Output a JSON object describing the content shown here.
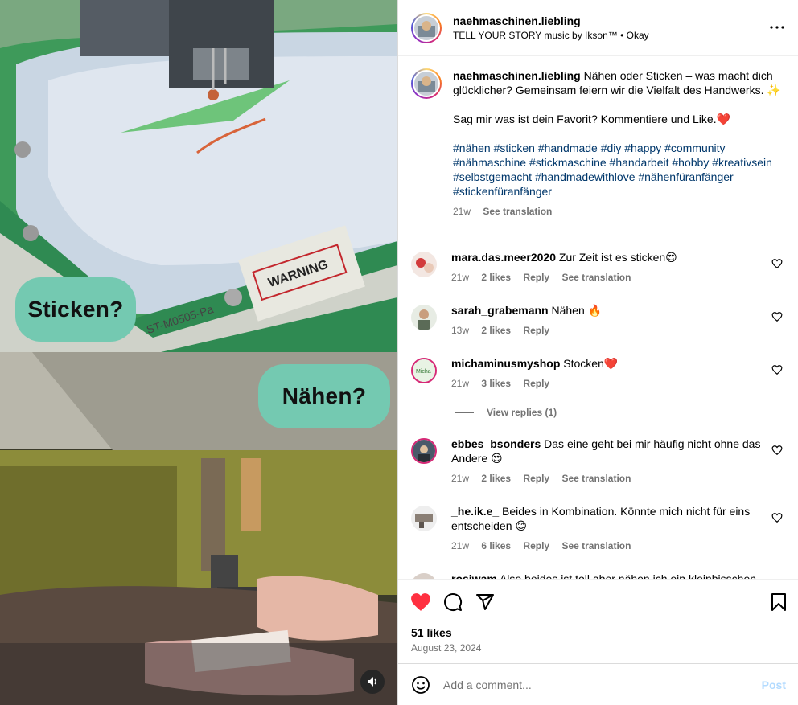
{
  "media": {
    "label_top": "Sticken?",
    "label_bottom": "Nähen?",
    "frame_text_warning": "WARNING",
    "frame_text_model": "ST-M0505-Pa"
  },
  "header": {
    "username": "naehmaschinen.liebling",
    "music": "TELL YOUR STORY music by Ikson™ • Okay"
  },
  "caption": {
    "username": "naehmaschinen.liebling",
    "text1": "Nähen oder Sticken – was macht dich glücklicher? Gemeinsam feiern wir die Vielfalt des Handwerks. ✨",
    "text2": "Sag mir was ist dein Favorit? Kommentiere und Like.❤️",
    "hashtags": "#nähen #sticken #handmade #diy #happy #community #nähmaschine #stickmaschine #handarbeit #hobby #kreativsein #selbstgemacht #handmadewithlove #nähenfüranfänger #stickenfüranfänger",
    "time": "21w",
    "see_translation": "See translation"
  },
  "comments": [
    {
      "user": "mara.das.meer2020",
      "text": "Zur Zeit ist es sticken😍",
      "time": "21w",
      "likes": "2 likes",
      "reply": "Reply",
      "translate": "See translation"
    },
    {
      "user": "sarah_grabemann",
      "text": "Nähen 🔥",
      "time": "13w",
      "likes": "2 likes",
      "reply": "Reply",
      "translate": ""
    },
    {
      "user": "michaminusmyshop",
      "text": "Stocken❤️",
      "time": "21w",
      "likes": "3 likes",
      "reply": "Reply",
      "translate": "",
      "view_replies": "View replies (1)"
    },
    {
      "user": "ebbes_bsonders",
      "text": "Das eine geht bei mir häufig nicht ohne das Andere 😍",
      "time": "21w",
      "likes": "2 likes",
      "reply": "Reply",
      "translate": "See translation"
    },
    {
      "user": "_he.ik.e_",
      "text": "Beides in Kombination. Könnte mich nicht für eins entscheiden 😊",
      "time": "21w",
      "likes": "6 likes",
      "reply": "Reply",
      "translate": "See translation"
    },
    {
      "user": "rosiwam",
      "text": "Also beides ist toll aber nähen ich ein kleinbisschen",
      "time": "",
      "likes": "",
      "reply": "",
      "translate": ""
    }
  ],
  "actions": {
    "likes": "51 likes",
    "date": "August 23, 2024"
  },
  "add_comment": {
    "placeholder": "Add a comment...",
    "post": "Post"
  },
  "colors": {
    "like_red": "#ff3040",
    "link_blue": "#00376b",
    "pill_teal": "#74c9b1",
    "post_disabled": "#b3dbff"
  }
}
